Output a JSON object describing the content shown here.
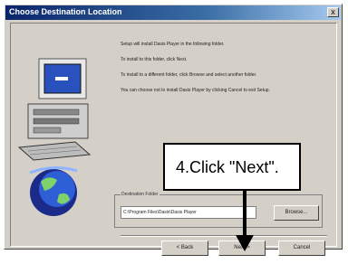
{
  "dialog": {
    "title": "Choose Destination Location",
    "close_glyph": "x"
  },
  "message": {
    "line1": "Setup will install Dasis Player in the following folder.",
    "line2": "To install to this folder, click Next.",
    "line3": "To install to a different folder, click Browse and select another folder.",
    "line4": "You can choose not to install Dasis Player by clicking Cancel to exit Setup."
  },
  "destination": {
    "group_label": "Destination Folder",
    "path": "C:\\Program Files\\Dasis\\Dasis Player",
    "browse_label": "Browse..."
  },
  "buttons": {
    "back": "< Back",
    "next": "Next >",
    "cancel": "Cancel"
  },
  "callout": {
    "text": "4.Click \"Next\"."
  },
  "icons": [
    "computer-icon",
    "globe-icon",
    "close-icon",
    "arrow-down-icon"
  ]
}
